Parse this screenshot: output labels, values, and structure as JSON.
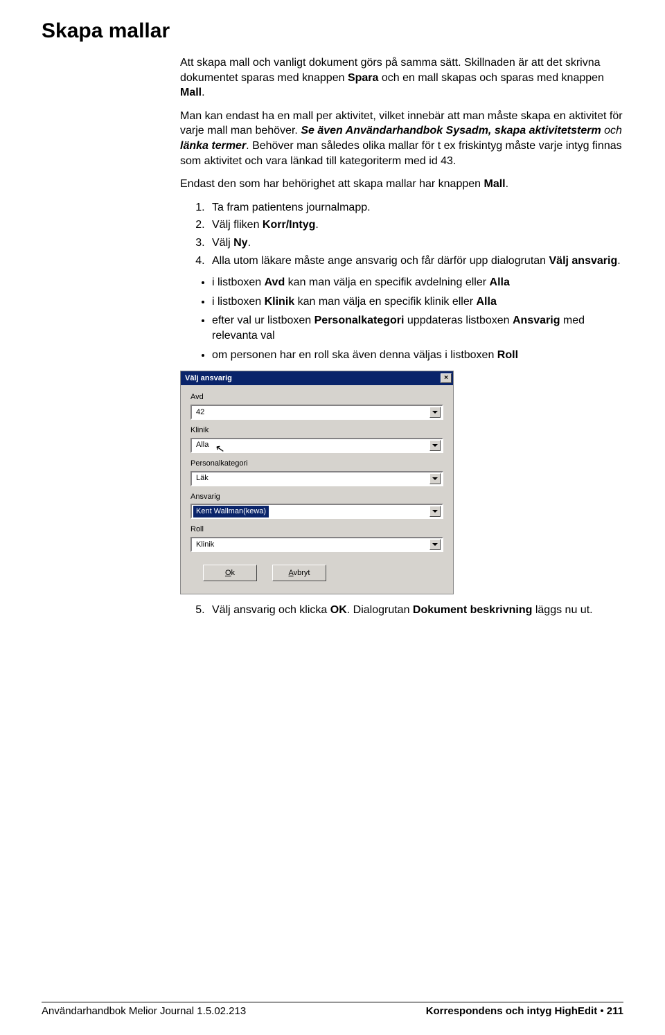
{
  "heading": "Skapa mallar",
  "p1": {
    "a": "Att skapa mall och vanligt dokument görs på samma sätt. Skillnaden är att det skrivna dokumentet sparas med knappen ",
    "b1": "Spara",
    "b": " och en mall skapas och sparas med knappen ",
    "b2": "Mall",
    "c": "."
  },
  "p2": {
    "a": "Man kan endast ha en mall per aktivitet, vilket innebär att man måste skapa en aktivitet för varje mall man behöver. ",
    "i1": "Se även Användarhandbok Sysadm, skapa aktivitetsterm",
    "b": " och ",
    "i2": "länka termer",
    "c": ". Behöver man således olika mallar för t ex friskintyg måste varje intyg finnas som aktivitet och vara länkad till kategoriterm med id 43."
  },
  "p3": {
    "a": "Endast den som har behörighet att skapa mallar har knappen ",
    "b1": "Mall",
    "b": "."
  },
  "steps": {
    "s1": "Ta fram patientens journalmapp.",
    "s2a": "Välj fliken ",
    "s2b": "Korr/Intyg",
    "s2c": ".",
    "s3a": "Välj ",
    "s3b": "Ny",
    "s3c": ".",
    "s4a": "Alla utom läkare måste ange ansvarig och får därför upp dialogrutan ",
    "s4b": "Välj ansvarig",
    "s4c": "."
  },
  "bullets": {
    "b1a": "i listboxen ",
    "b1b": "Avd",
    "b1c": " kan man välja en specifik avdelning eller ",
    "b1d": "Alla",
    "b2a": "i listboxen ",
    "b2b": "Klinik",
    "b2c": " kan man välja en specifik klinik eller ",
    "b2d": "Alla",
    "b3a": "efter val ur listboxen ",
    "b3b": "Personalkategori",
    "b3c": " uppdateras listboxen ",
    "b3d": "Ansvarig",
    "b3e": " med relevanta val",
    "b4a": "om personen har en roll ska även denna väljas i listboxen ",
    "b4b": "Roll"
  },
  "dialog": {
    "title": "Välj ansvarig",
    "labels": {
      "avd": "Avd",
      "klinik": "Klinik",
      "personalkategori": "Personalkategori",
      "ansvarig": "Ansvarig",
      "roll": "Roll"
    },
    "values": {
      "avd": "42",
      "klinik": "Alla",
      "personalkategori": "Läk",
      "ansvarig": "Kent Wallman(kewa)",
      "roll": "Klinik"
    },
    "buttons": {
      "ok_u": "O",
      "ok_rest": "k",
      "cancel_u": "A",
      "cancel_rest": "vbryt"
    }
  },
  "step5": {
    "a": "Välj ansvarig och klicka ",
    "b1": "OK",
    "b": ". Dialogrutan ",
    "b2": "Dokument beskrivning",
    "c": " läggs nu ut."
  },
  "footer": {
    "left": "Användarhandbok Melior Journal 1.5.02.213",
    "right_a": "Korrespondens och intyg HighEdit",
    "dot": " • ",
    "right_b": "211"
  }
}
